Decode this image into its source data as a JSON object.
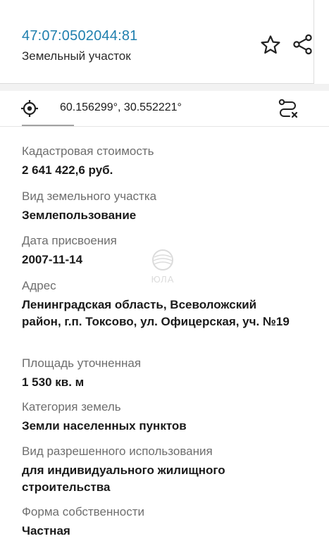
{
  "header": {
    "cadastral_number": "47:07:0502044:81",
    "object_type": "Земельный участок",
    "icons": [
      "star-icon",
      "share-icon"
    ]
  },
  "location": {
    "coordinates": "60.156299°, 30.552221°",
    "icons": [
      "target-icon",
      "route-icon"
    ]
  },
  "watermark": {
    "text": "ЮЛА"
  },
  "fields": [
    {
      "label": "Кадастровая стоимость",
      "value": "2 641 422,6 руб."
    },
    {
      "label": "Вид земельного участка",
      "value": "Землепользование"
    },
    {
      "label": "Дата присвоения",
      "value": "2007-11-14"
    },
    {
      "label": "Адрес",
      "value": "Ленинградская область, Всеволожский район, г.п. Токсово, ул. Офицерская, уч. №19"
    },
    {
      "label": "Площадь уточненная",
      "value": "1 530 кв. м"
    },
    {
      "label": "Категория земель",
      "value": "Земли населенных пунктов"
    },
    {
      "label": "Вид разрешенного использования",
      "value": "для индивидуального жилищного строительства"
    },
    {
      "label": "Форма собственности",
      "value": "Частная"
    }
  ],
  "colors": {
    "accent": "#1f7fae",
    "label": "#6e6e6e",
    "divider": "#f2f2f2"
  }
}
